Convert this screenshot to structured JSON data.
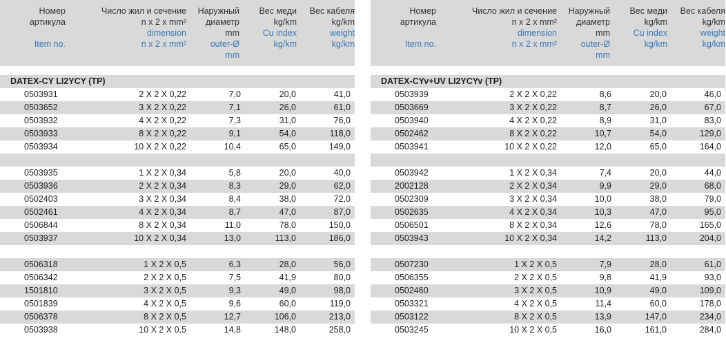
{
  "header": {
    "article_ru": [
      "Номер",
      "артикула"
    ],
    "article_en": "Item no.",
    "dimension_ru": [
      "Число жил и сечение",
      "n x 2 x mm²"
    ],
    "dimension_en": [
      "dimension",
      "n x 2 x mm²"
    ],
    "outer_ru": [
      "Наружный",
      "диаметр",
      "mm"
    ],
    "outer_en": [
      "outer-Ø",
      "mm"
    ],
    "cu_ru": [
      "Вес меди",
      "kg/km"
    ],
    "cu_en": [
      "Cu index",
      "kg/km"
    ],
    "weight_ru": [
      "Вес кабеля",
      "kg/km"
    ],
    "weight_en": [
      "weight",
      "kg/km"
    ]
  },
  "left": {
    "title": "DATEX-CY LI2YCY (TP)",
    "groups": [
      [
        [
          "0503931",
          "2 X 2 X 0,22",
          "7,0",
          "20,0",
          "41,0"
        ],
        [
          "0503652",
          "3 X 2 X 0,22",
          "7,1",
          "26,0",
          "61,0"
        ],
        [
          "0503932",
          "4 X 2 X 0,22",
          "7,3",
          "31,0",
          "76,0"
        ],
        [
          "0503933",
          "8 X 2 X 0,22",
          "9,1",
          "54,0",
          "118,0"
        ],
        [
          "0503934",
          "10 X 2 X 0,22",
          "10,4",
          "65,0",
          "149,0"
        ]
      ],
      [
        [
          "0503935",
          "1 X 2 X 0,34",
          "5,8",
          "20,0",
          "40,0"
        ],
        [
          "0503936",
          "2 X 2 X 0,34",
          "8,3",
          "29,0",
          "62,0"
        ],
        [
          "0502403",
          "3 X 2 X 0,34",
          "8,4",
          "38,0",
          "72,0"
        ],
        [
          "0502461",
          "4 X 2 X 0,34",
          "8,7",
          "47,0",
          "87,0"
        ],
        [
          "0506844",
          "8 X 2 X 0,34",
          "11,0",
          "78,0",
          "150,0"
        ],
        [
          "0503937",
          "10 X 2 X 0,34",
          "13,0",
          "113,0",
          "186,0"
        ]
      ],
      [
        [
          "0506318",
          "1 X 2 X 0,5",
          "6,3",
          "28,0",
          "56,0"
        ],
        [
          "0506342",
          "2 X 2 X 0,5",
          "7,5",
          "41,9",
          "80,0"
        ],
        [
          "1501810",
          "3 X 2 X 0,5",
          "9,3",
          "49,0",
          "98,0"
        ],
        [
          "0501839",
          "4 X 2 X 0,5",
          "9,6",
          "60,0",
          "119,0"
        ],
        [
          "0506378",
          "8 X 2 X 0,5",
          "12,7",
          "106,0",
          "213,0"
        ],
        [
          "0503938",
          "10 X 2 X 0,5",
          "14,8",
          "148,0",
          "258,0"
        ]
      ]
    ]
  },
  "right": {
    "title": "DATEX-CYv+UV LI2YCYv (TP)",
    "groups": [
      [
        [
          "0503939",
          "2 X 2 X 0,22",
          "8,6",
          "20,0",
          "46,0"
        ],
        [
          "0503669",
          "3 X 2 X 0,22",
          "8,7",
          "26,0",
          "67,0"
        ],
        [
          "0503940",
          "4 X 2 X 0,22",
          "8,9",
          "31,0",
          "83,0"
        ],
        [
          "0502462",
          "8 X 2 X 0,22",
          "10,7",
          "54,0",
          "129,0"
        ],
        [
          "0503941",
          "10 X 2 X 0,22",
          "12,0",
          "65,0",
          "164,0"
        ]
      ],
      [
        [
          "0503942",
          "1 X 2 X 0,34",
          "7,4",
          "20,0",
          "44,0"
        ],
        [
          "2002128",
          "2 X 2 X 0,34",
          "9,9",
          "29,0",
          "68,0"
        ],
        [
          "0502309",
          "3 X 2 X 0,34",
          "10,0",
          "38,0",
          "79,0"
        ],
        [
          "0502635",
          "4 X 2 X 0,34",
          "10,3",
          "47,0",
          "95,0"
        ],
        [
          "0506501",
          "8 X 2 X 0,34",
          "12,6",
          "78,0",
          "165,0"
        ],
        [
          "0503943",
          "10 X 2 X 0,34",
          "14,2",
          "113,0",
          "204,0"
        ]
      ],
      [
        [
          "0507230",
          "1 X 2 X 0,5",
          "7,9",
          "28,0",
          "61,0"
        ],
        [
          "0506355",
          "2 X 2 X 0,5",
          "9,8",
          "41,9",
          "93,0"
        ],
        [
          "0502460",
          "3 X 2 X 0,5",
          "10,9",
          "49,0",
          "109,0"
        ],
        [
          "0503321",
          "4 X 2 X 0,5",
          "11,4",
          "60,0",
          "178,0"
        ],
        [
          "0503122",
          "8 X 2 X 0,5",
          "13,9",
          "147,0",
          "234,0"
        ],
        [
          "0503245",
          "10 X 2 X 0,5",
          "16,0",
          "161,0",
          "284,0"
        ]
      ]
    ]
  }
}
